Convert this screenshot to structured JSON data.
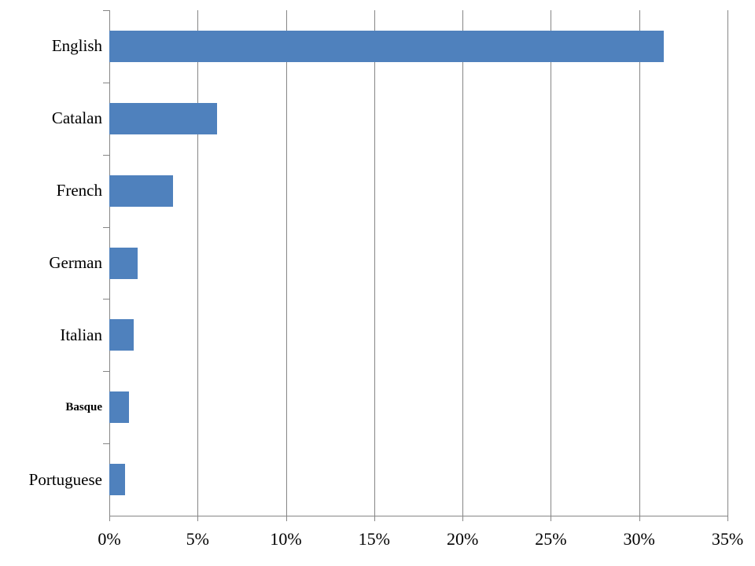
{
  "chart_data": {
    "type": "bar",
    "orientation": "horizontal",
    "title": "",
    "subtitle": "",
    "xlabel": "",
    "ylabel": "",
    "categories": [
      "English",
      "Catalan",
      "French",
      "German",
      "Italian",
      "Basque",
      "Portuguese"
    ],
    "values": [
      31.4,
      6.1,
      3.6,
      1.6,
      1.4,
      1.1,
      0.9
    ],
    "series": [
      {
        "name": "",
        "values": [
          31.4,
          6.1,
          3.6,
          1.6,
          1.4,
          1.1,
          0.9
        ]
      }
    ],
    "xlim": [
      0,
      35
    ],
    "xticks": [
      0,
      5,
      10,
      15,
      20,
      25,
      30,
      35
    ],
    "xtick_labels": [
      "0%",
      "5%",
      "10%",
      "15%",
      "20%",
      "25%",
      "30%",
      "35%"
    ],
    "value_format": "percent",
    "grid": {
      "vertical": true,
      "horizontal": false,
      "color": "#868686"
    },
    "legend": {
      "visible": false,
      "position": "none",
      "entries": []
    },
    "colors": {
      "bar_fill": "#4F81BD",
      "axis": "#868686",
      "gridline": "#868686",
      "text": "#000000",
      "background": "#FFFFFF"
    },
    "annotations": []
  }
}
